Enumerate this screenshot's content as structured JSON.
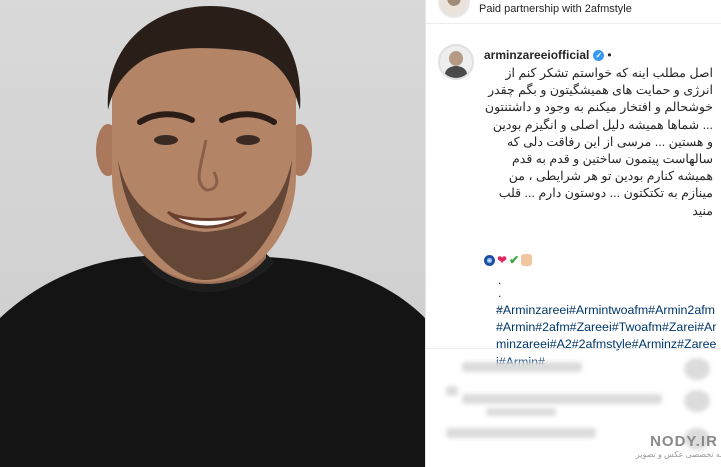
{
  "header": {
    "paid_partnership": "Paid partnership with 2afmstyle"
  },
  "post": {
    "username": "arminzareeiofficial",
    "verified": true,
    "separator": "•",
    "caption": "اصل مطلب اینه که خواستم تشکر کنم از انرژی و حمایت های همیشگیتون و بگم چقدر خوشحالم و افتخار میکنم به وجود و داشتنتون ... شماها همیشه دلیل اصلی و انگیزم بودین و هستین ... مرسی از این رفاقت دلی که سالهاست پیتمون ساختین و قدم به قدم همیشه کنارم بودین تو هر شرایطی ، من مینازم به تکتکتون ... دوستون دارم ... قلب منید",
    "emojis": [
      "eye-icon",
      "heart-icon",
      "check-icon",
      "praying-hands-icon"
    ],
    "dots": [
      ".",
      ".",
      "."
    ],
    "hashtags": "#Arminzareei#Armintwoafm#Armin2afm#Armin#2afm#Zareei#Twoafm#Zarei#Arminzareei#A2#2afmstyle#Arminz#Zareei#Armin#"
  },
  "watermark": {
    "site": "NODY.IR",
    "tagline": "مجله تخصصی عکس و تصویر"
  },
  "colors": {
    "verified": "#3897f0",
    "hashtag": "#00376b",
    "text": "#262626"
  }
}
